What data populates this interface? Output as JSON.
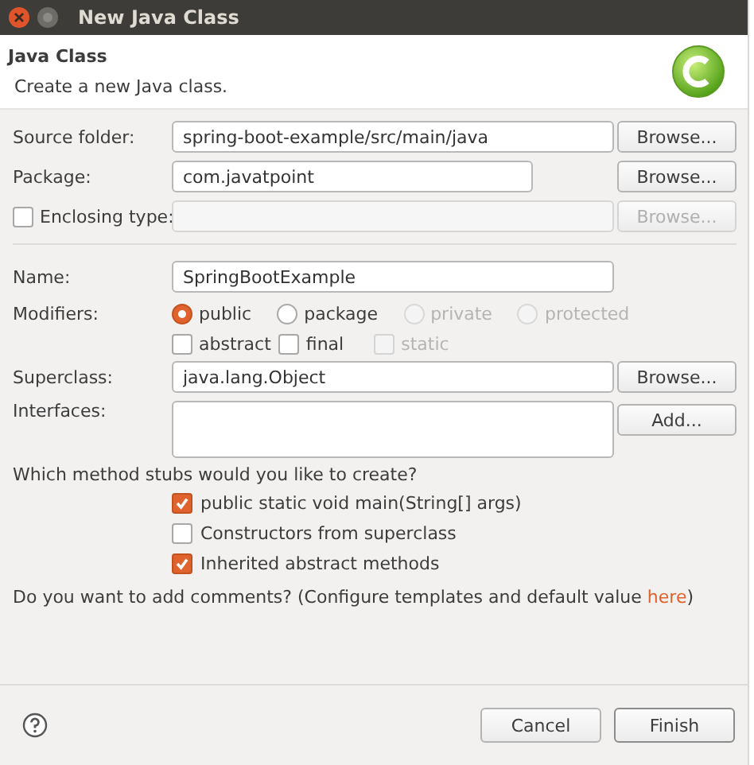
{
  "window": {
    "title": "New Java Class"
  },
  "header": {
    "title": "Java Class",
    "description": "Create a new Java class."
  },
  "location": [
    {
      "kind": "field",
      "label": "Source folder:",
      "value": "spring-boot-example/src/main/java",
      "disabled": false,
      "button": {
        "label": "Browse...",
        "disabled": false
      }
    },
    {
      "kind": "field",
      "label": "Package:",
      "value": "com.javatpoint",
      "disabled": false,
      "button": {
        "label": "Browse...",
        "disabled": false
      }
    },
    {
      "kind": "check-field",
      "label": "Enclosing type:",
      "checked": false,
      "disabled": true,
      "button": {
        "label": "Browse...",
        "disabled": true
      }
    }
  ],
  "name": {
    "label": "Name:",
    "value": "SpringBootExample"
  },
  "modifiers": {
    "label": "Modifiers:",
    "access": [
      {
        "label": "public",
        "selected": true,
        "disabled": false
      },
      {
        "label": "package",
        "selected": false,
        "disabled": false
      },
      {
        "label": "private",
        "selected": false,
        "disabled": true
      },
      {
        "label": "protected",
        "selected": false,
        "disabled": true
      }
    ],
    "flags": [
      {
        "label": "abstract",
        "checked": false,
        "disabled": false
      },
      {
        "label": "final",
        "checked": false,
        "disabled": false
      },
      {
        "label": "static",
        "checked": false,
        "disabled": true
      }
    ]
  },
  "superclass": {
    "label": "Superclass:",
    "value": "java.lang.Object",
    "button": "Browse..."
  },
  "interfaces": {
    "label": "Interfaces:",
    "button": "Add..."
  },
  "stubs": {
    "question": "Which method stubs would you like to create?",
    "options": [
      {
        "label": "public static void main(String[] args)",
        "checked": true
      },
      {
        "label": "Constructors from superclass",
        "checked": false
      },
      {
        "label": "Inherited abstract methods",
        "checked": true
      }
    ]
  },
  "comments": {
    "question_before": "Do you want to add comments? (Configure templates and default value ",
    "link": "here",
    "question_after": ")"
  },
  "buttons": [
    {
      "label": "Cancel",
      "default": false
    },
    {
      "label": "Finish",
      "default": true
    }
  ]
}
